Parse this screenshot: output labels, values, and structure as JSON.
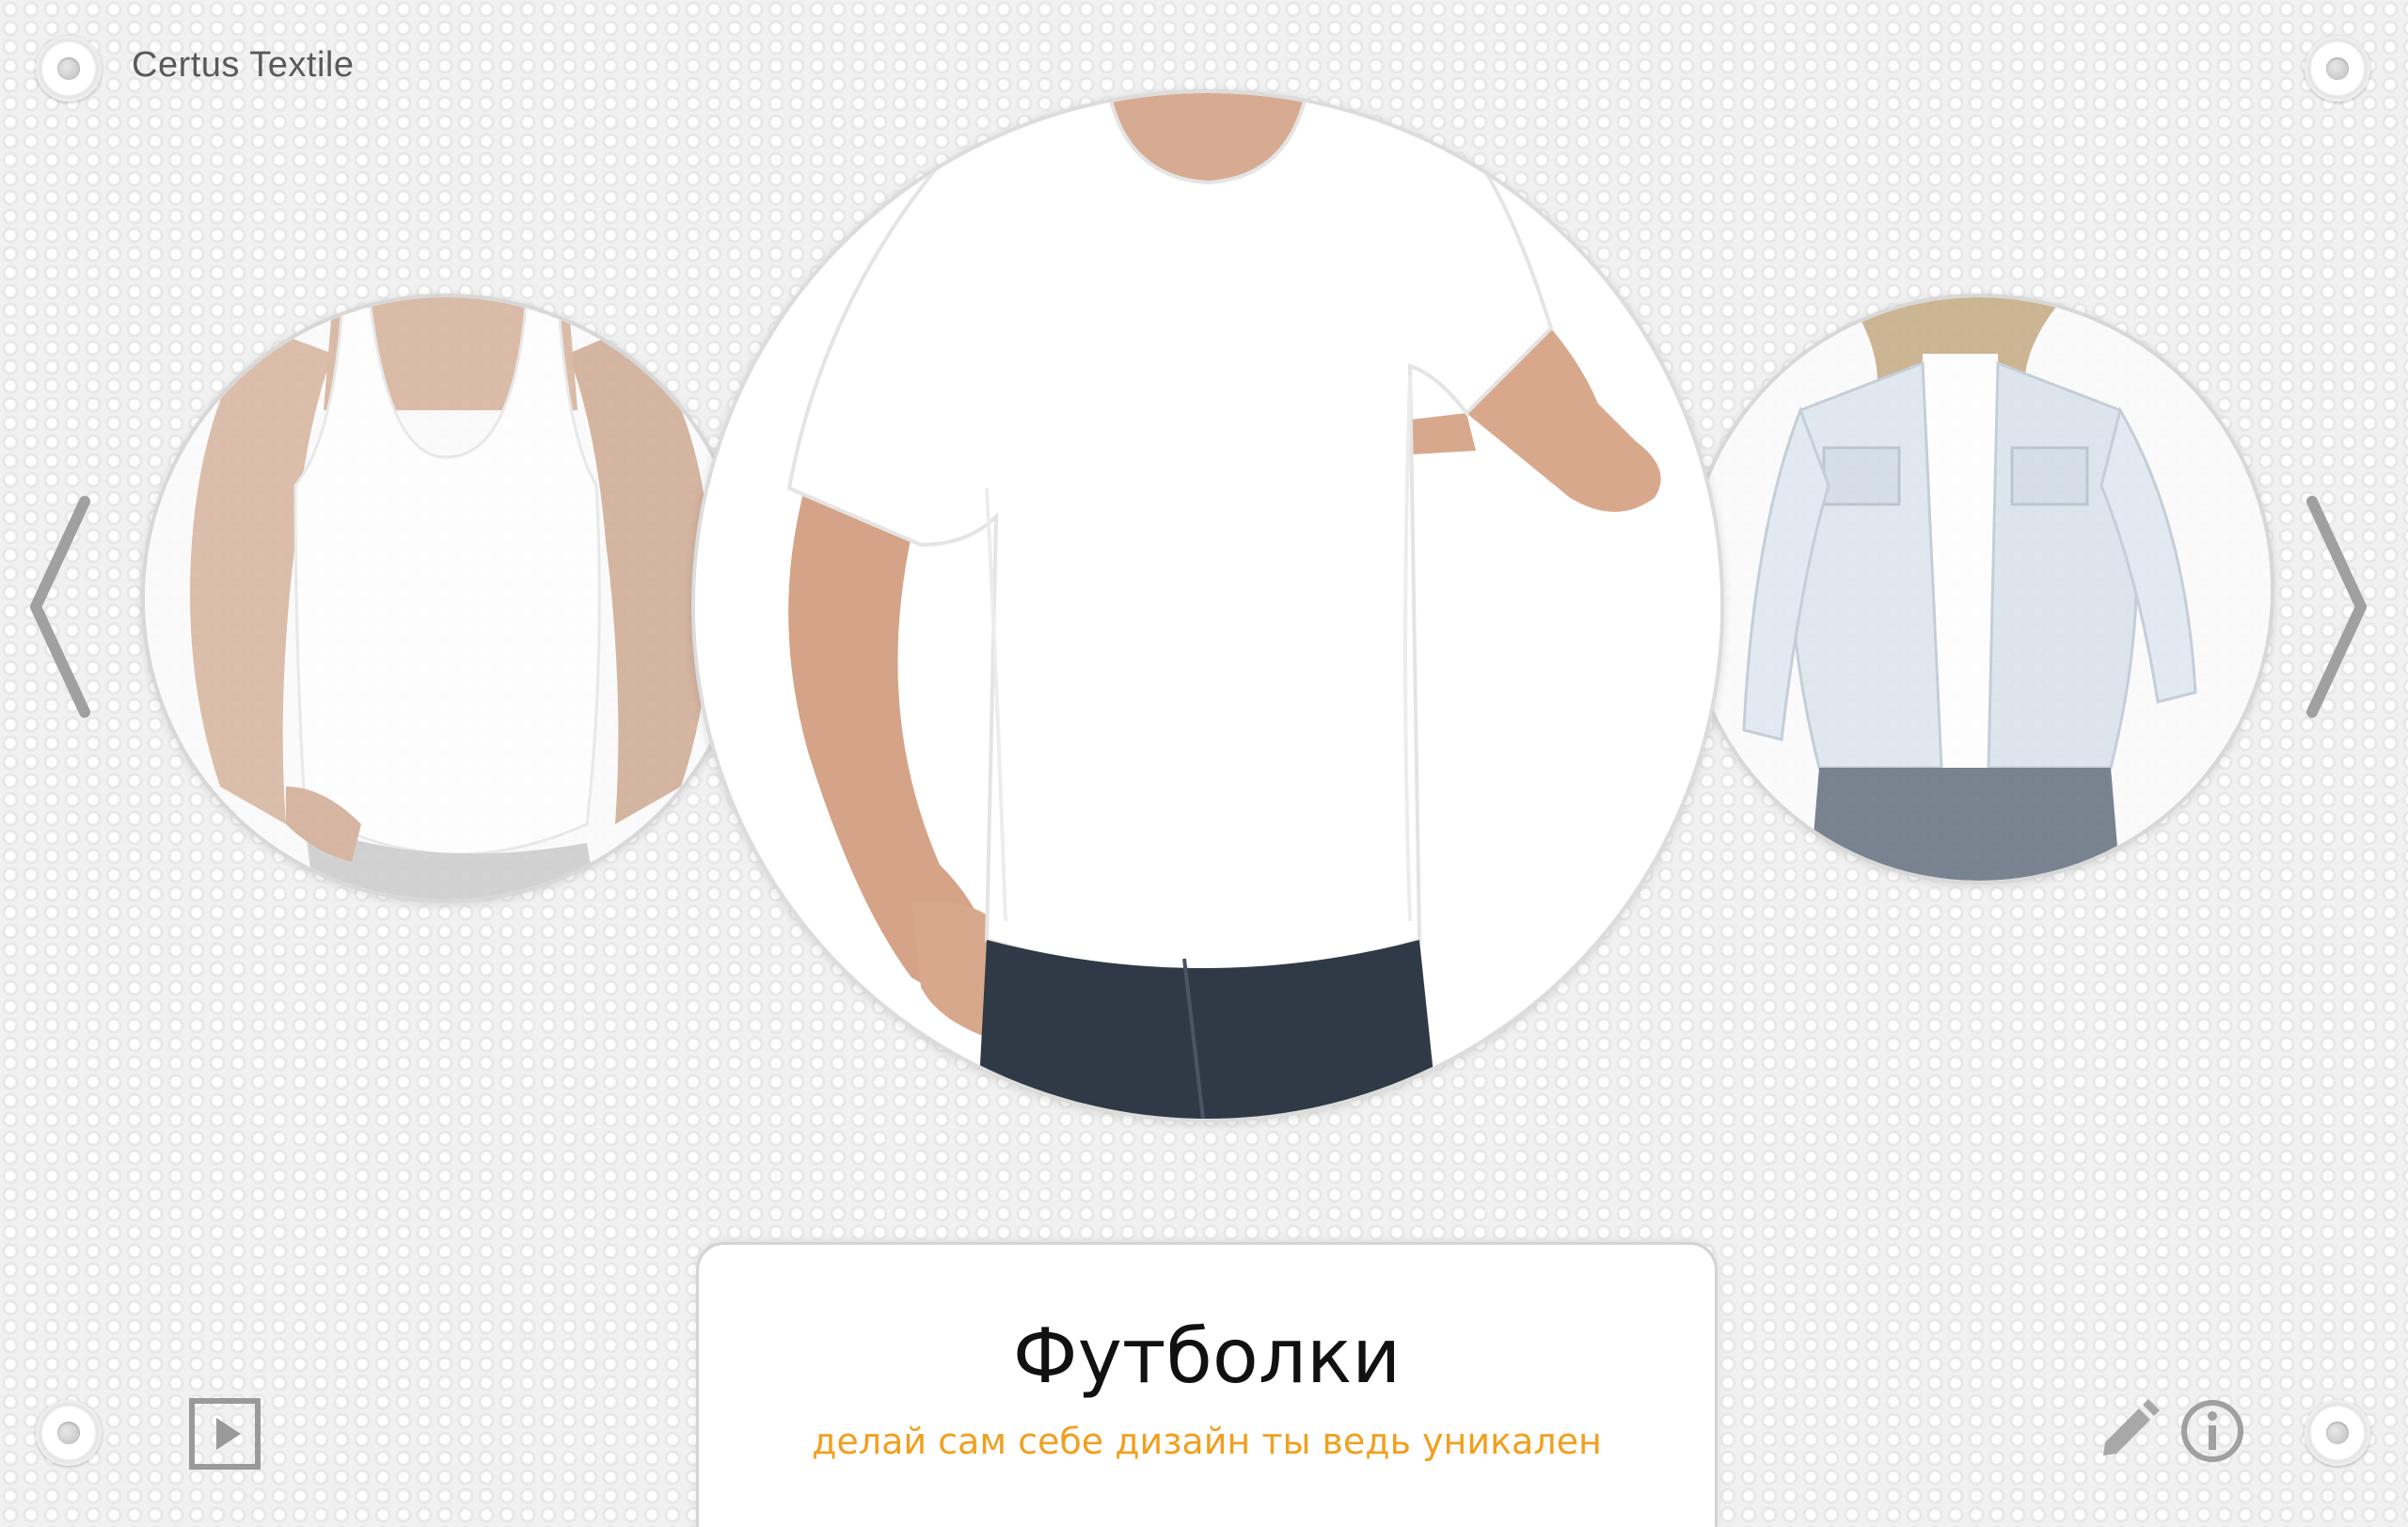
{
  "header": {
    "app_title": "Certus Textile"
  },
  "carousel": {
    "items": [
      {
        "name": "tank-top",
        "position": "left"
      },
      {
        "name": "t-shirt",
        "position": "center"
      },
      {
        "name": "denim-jacket",
        "position": "right"
      }
    ]
  },
  "caption": {
    "title": "Футболки",
    "subtitle": "делай сам себе дизайн ты ведь уникален"
  },
  "icons": {
    "prev": "chevron-left-icon",
    "next": "chevron-right-icon",
    "play": "play-icon",
    "edit": "pencil-icon",
    "info": "info-icon"
  },
  "colors": {
    "accent": "#f0a020",
    "background": "#f1f1f1",
    "icon_gray": "#a0a0a0"
  }
}
